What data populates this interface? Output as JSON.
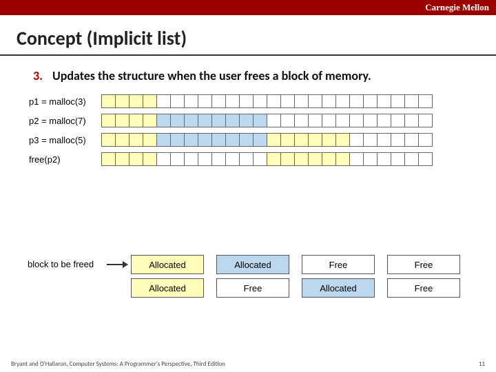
{
  "header": {
    "brand": "Carnegie Mellon"
  },
  "title": "Concept (Implicit list)",
  "bullet": {
    "number": "3.",
    "text": "Updates the structure when the user frees a block of memory."
  },
  "heap_rows": [
    {
      "label": "p1 = malloc(3)",
      "cells": [
        "y",
        "y",
        "y",
        "y",
        "e",
        "e",
        "e",
        "e",
        "e",
        "e",
        "e",
        "e",
        "e",
        "e",
        "e",
        "e",
        "e",
        "e",
        "e",
        "e",
        "e",
        "e",
        "e",
        "e"
      ]
    },
    {
      "label": "p2 = malloc(7)",
      "cells": [
        "y",
        "y",
        "y",
        "y",
        "b",
        "b",
        "b",
        "b",
        "b",
        "b",
        "b",
        "b",
        "e",
        "e",
        "e",
        "e",
        "e",
        "e",
        "e",
        "e",
        "e",
        "e",
        "e",
        "e"
      ]
    },
    {
      "label": "p3 = malloc(5)",
      "cells": [
        "y",
        "y",
        "y",
        "y",
        "b",
        "b",
        "b",
        "b",
        "b",
        "b",
        "b",
        "b",
        "y",
        "y",
        "y",
        "y",
        "y",
        "y",
        "e",
        "e",
        "e",
        "e",
        "e",
        "e"
      ]
    },
    {
      "label": "free(p2)",
      "cells": [
        "y",
        "y",
        "y",
        "y",
        "e",
        "e",
        "e",
        "e",
        "e",
        "e",
        "e",
        "e",
        "y",
        "y",
        "y",
        "y",
        "y",
        "y",
        "e",
        "e",
        "e",
        "e",
        "e",
        "e"
      ]
    }
  ],
  "lower": {
    "label": "block to be freed",
    "rows": [
      {
        "blocks": [
          {
            "text": "Allocated",
            "color": "yellow"
          },
          {
            "text": "Allocated",
            "color": "blue"
          },
          {
            "text": "Free",
            "color": "empty"
          },
          {
            "text": "Free",
            "color": "empty"
          }
        ]
      },
      {
        "blocks": [
          {
            "text": "Allocated",
            "color": "yellow"
          },
          {
            "text": "Free",
            "color": "empty"
          },
          {
            "text": "Allocated",
            "color": "blue"
          },
          {
            "text": "Free",
            "color": "empty"
          }
        ]
      }
    ]
  },
  "footer": {
    "left": "Bryant and O'Hallaron, Computer Systems: A Programmer's Perspective, Third Edition",
    "right": "11"
  }
}
